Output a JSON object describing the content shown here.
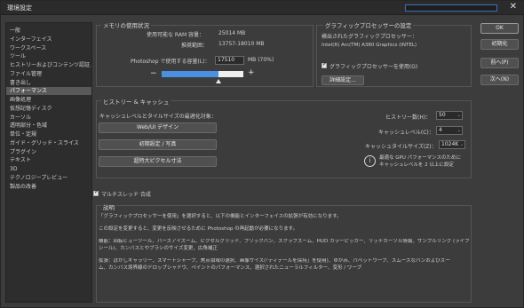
{
  "window": {
    "title": "環境設定",
    "close_label": "✕"
  },
  "search": {
    "placeholder": ""
  },
  "sidebar": {
    "items": [
      {
        "label": "一般"
      },
      {
        "label": "インターフェイス"
      },
      {
        "label": "ワークスペース"
      },
      {
        "label": "ツール"
      },
      {
        "label": "ヒストリーおよびコンテンツ認証..."
      },
      {
        "label": "ファイル管理"
      },
      {
        "label": "書き出し"
      },
      {
        "label": "パフォーマンス",
        "selected": true
      },
      {
        "label": "画像処理"
      },
      {
        "label": "仮想記憶ディスク"
      },
      {
        "label": "カーソル"
      },
      {
        "label": "透明部分・色域"
      },
      {
        "label": "単位・定規"
      },
      {
        "label": "ガイド・グリッド・スライス"
      },
      {
        "label": "プラグイン"
      },
      {
        "label": "テキスト"
      },
      {
        "label": "3D"
      },
      {
        "label": "テクノロジープレビュー"
      },
      {
        "label": "製品の改善"
      }
    ]
  },
  "memory": {
    "legend": "メモリの使用状況",
    "available_label": "使用可能な RAM 容量：",
    "available_value": "25014 MB",
    "ideal_label": "推奨範囲：",
    "ideal_value": "13757-18010 MB",
    "use_label": "Photoshop で使用する容量(L)：",
    "use_value": "17510",
    "use_unit": "MB (70%)",
    "minus": "−",
    "plus": "+",
    "slider_fraction": 0.7
  },
  "gpu": {
    "legend": "グラフィックプロセッサーの設定",
    "detected_label": "検出されたグラフィックプロセッサー：",
    "detected_value": "Intel(R) Arc(TM) A380 Graphics (INTEL)",
    "use_gpu_label": "グラフィックプロセッサーを使用(G)",
    "use_gpu_checked": true,
    "advanced_button": "詳細設定..."
  },
  "history": {
    "legend": "ヒストリー & キャッシュ",
    "optimize_label": "キャッシュレベルとタイルサイズの最適化対象：",
    "btn_web": "Web/UI デザイン",
    "btn_default": "初期設定 / 写真",
    "btn_huge": "超特大ピクセル寸法",
    "history_states_label": "ヒストリー数(H)：",
    "history_states_value": "50",
    "cache_levels_label": "キャッシュレベル(C)：",
    "cache_levels_value": "4",
    "cache_tile_label": "キャッシュタイルサイズ(Z)：",
    "cache_tile_value": "1024K",
    "info_icon": "i",
    "info_text_line1": "最適な GPU パフォーマンスのために",
    "info_text_line2": "キャッシュレベルを 2 以上に設定"
  },
  "multithread": {
    "label": "マルチスレッド 合成",
    "checked": true
  },
  "description": {
    "legend": "説明",
    "line1": "「グラフィックプロセッサーを使用」を選択すると、以下の機能とインターフェイスの拡張が有効になります。",
    "line2": "この設定を変更すると、変更を反映させるために Photoshop の再起動が必要になります。",
    "line3": "機能：回転ビューツール、バーズアイズーム、ピクセルグリッド、フリックパン、スクラブズーム、HUD カラーピッカー、リッチカーソル情報、サンプルリング (ライブ",
    "line4": "シール)、カンバスとやブラシのサイズ変更、広角補正",
    "line5": "拡張：ぼかしギャラリー、スマートシャープ、焦点領域の選択、画像サイズ(「ディテールを保持」を使用)、ゆがみ、パペットワープ、スムーズなパンおよびズー",
    "line6": "ム、カンバス境界線のドロップシャドウ、ペイントのパフォーマンス、選択されたニューラルフィルター、変形 / ワープ"
  },
  "buttons": {
    "ok": "OK",
    "reset": "初期化",
    "prev": "前へ(P)",
    "next": "次へ(N)"
  },
  "colors": {
    "slider_fill": "#4a90e2",
    "slider_track": "#f0f0f0"
  }
}
